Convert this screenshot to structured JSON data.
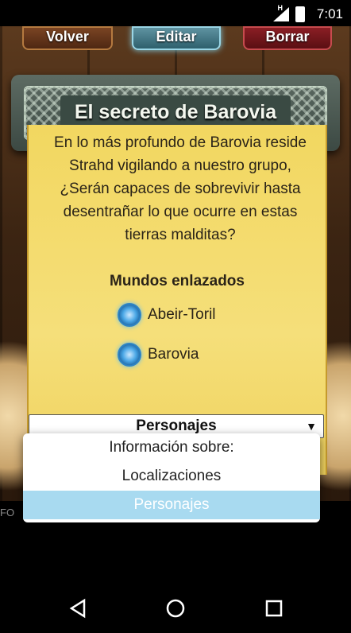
{
  "status": {
    "time": "7:01",
    "network_mark": "H"
  },
  "toolbar": {
    "volver": "Volver",
    "editar": "Editar",
    "borrar": "Borrar"
  },
  "banner": {
    "title": "El secreto de Barovia"
  },
  "card": {
    "description": "En lo más profundo de Barovia reside Strahd vigilando a nuestro grupo, ¿Serán capaces de sobrevivir hasta desentrañar lo que ocurre en estas tierras malditas?",
    "linked_title": "Mundos enlazados",
    "worlds": [
      "Abeir-Toril",
      "Barovia"
    ]
  },
  "select": {
    "value": "Personajes"
  },
  "dropdown": {
    "items": [
      "Información sobre:",
      "Localizaciones",
      "Personajes"
    ],
    "selected": "Personajes"
  },
  "lower": {
    "partial_text": "FO"
  },
  "colors": {
    "card": "#f2d760",
    "selected_option": "#a8daf0"
  }
}
